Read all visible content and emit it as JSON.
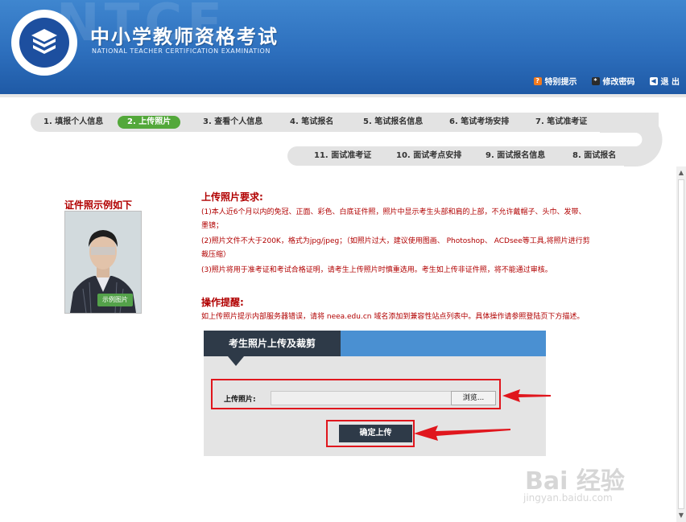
{
  "header": {
    "watermark": "NTCE",
    "title": "中小学教师资格考试",
    "subtitle": "NATIONAL TEACHER CERTIFICATION EXAMINATION",
    "links": [
      {
        "label": "特别提示"
      },
      {
        "label": "修改密码"
      },
      {
        "label": "退 出"
      }
    ]
  },
  "steps": {
    "row1": [
      {
        "label": "1. 填报个人信息"
      },
      {
        "label": "2. 上传照片"
      },
      {
        "label": "3. 查看个人信息"
      },
      {
        "label": "4. 笔试报名"
      },
      {
        "label": "5. 笔试报名信息"
      },
      {
        "label": "6. 笔试考场安排"
      },
      {
        "label": "7. 笔试准考证"
      }
    ],
    "row2": [
      {
        "label": "11. 面试准考证"
      },
      {
        "label": "10. 面试考点安排"
      },
      {
        "label": "9. 面试报名信息"
      },
      {
        "label": "8. 面试报名"
      }
    ]
  },
  "sample": {
    "label": "证件照示例如下",
    "tag": "示例图片"
  },
  "requirements": {
    "title": "上传照片要求:",
    "items": [
      "(1)本人近6个月以内的免冠、正面、彩色、白底证件照，照片中显示考生头部和肩的上部，不允许戴帽子、头巾、发带、",
      "墨镜；",
      "(2)照片文件不大于200K，格式为jpg/jpeg；（如照片过大，建议使用图画、 Photoshop、 ACDsee等工具,将照片进行剪",
      "裁压缩）",
      "(3)照片将用于准考证和考试合格证明，请考生上传照片时慎重选用。考生如上传非证件照，将不能通过审核。"
    ]
  },
  "tips": {
    "title": "操作提醒:",
    "text": "如上传照片提示内部服务器错误，请将 neea.edu.cn 域名添加到兼容性站点列表中。具体操作请参照登陆页下方描述。"
  },
  "panel": {
    "tab": "考生照片上传及裁剪",
    "upload_label": "上传照片:",
    "browse": "浏览...",
    "submit": "确定上传"
  },
  "watermark": {
    "main": "Bai 经验",
    "url": "jingyan.baidu.com"
  },
  "colors": {
    "header_blue": "#2d6fbd",
    "active_step": "#53a83a",
    "alert_red": "#b10000",
    "highlight_red": "#e0161d",
    "panel_dark": "#2e3a48",
    "panel_blue": "#4a90d2"
  }
}
